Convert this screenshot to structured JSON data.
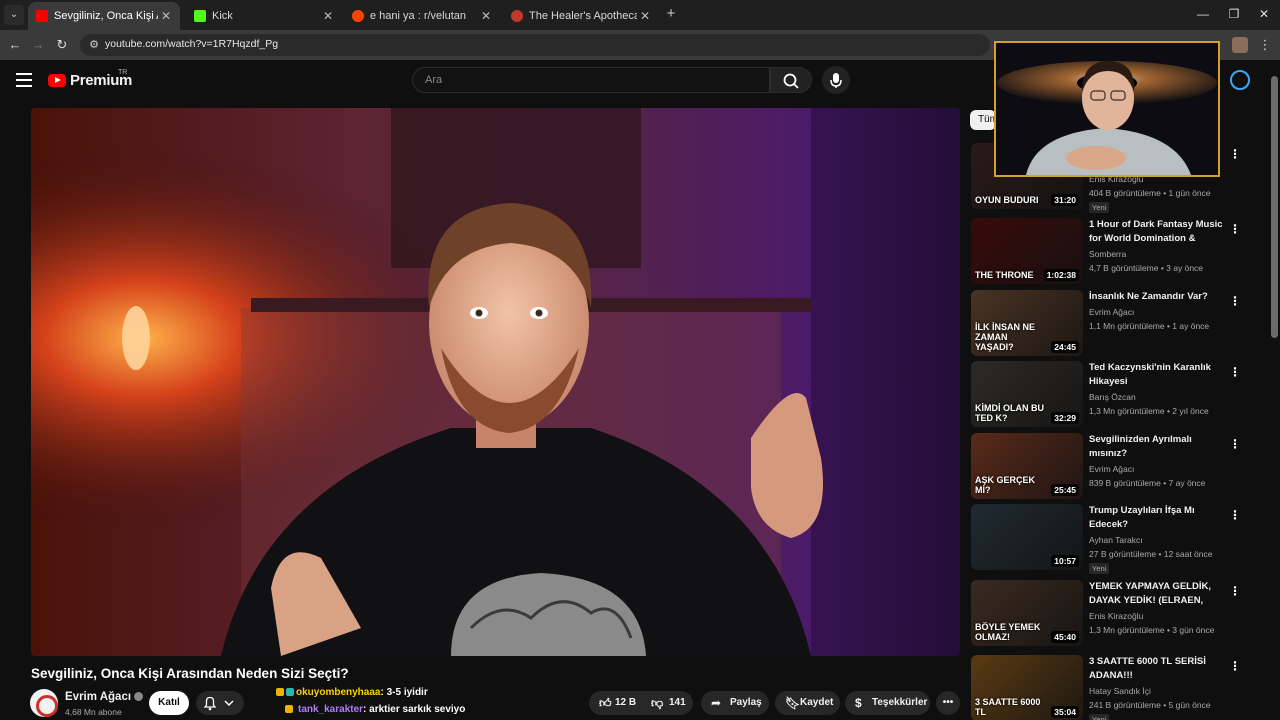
{
  "browser": {
    "tabs": [
      {
        "title": "Sevgiliniz, Onca Kişi Arasından",
        "favicon": "youtube-icon",
        "color": "#ff0000",
        "active": true
      },
      {
        "title": "Kick",
        "favicon": "kick-icon",
        "color": "#53fc18",
        "active": false
      },
      {
        "title": "e hani ya : r/velutan",
        "favicon": "reddit-icon",
        "color": "#ff4500",
        "active": false
      },
      {
        "title": "The Healer's Apothecary | Inkarr",
        "favicon": "site-icon",
        "color": "#c0392b",
        "active": false
      }
    ],
    "url": "youtube.com/watch?v=1R7Hqzdf_Pg"
  },
  "youtube": {
    "logo_text": "Premium",
    "region": "TR",
    "search_placeholder": "Ara"
  },
  "video": {
    "title": "Sevgiliniz, Onca Kişi Arasından Neden Sizi Seçti?",
    "channel": "Evrim Ağacı",
    "subscribers": "4,68 Mn abone",
    "join_label": "Katıl",
    "likes": "12 B",
    "dislikes": "141",
    "share_label": "Paylaş",
    "save_label": "Kaydet",
    "thanks_label": "Teşekkürler",
    "more_label": "•••"
  },
  "chat": [
    {
      "user": "okuyombenyhaaa",
      "message": ": 3-5 iyidir",
      "user_color": "#ffd200"
    },
    {
      "user": "tank_karakter",
      "message": ": arktier sarkık seviyo",
      "user_color": "#b07cff"
    }
  ],
  "sidebar": {
    "chip": "Tüm",
    "items": [
      {
        "title": "",
        "channel": "Enis Kirazoğlu",
        "meta": "404 B görüntüleme • 1 gün önce",
        "badge": "Yeni",
        "duration": "31:20",
        "thumb_text": "OYUN BUDURI",
        "thumb_color": "#2a1a1a"
      },
      {
        "title": "1 Hour of Dark Fantasy Music for World Domination & Villains",
        "channel": "Somberra",
        "meta": "4,7 B görüntüleme • 3 ay önce",
        "badge": "",
        "duration": "1:02:38",
        "thumb_text": "THE THRONE",
        "thumb_color": "#3a0a0a"
      },
      {
        "title": "İnsanlık Ne Zamandır Var?",
        "channel": "Evrim Ağacı",
        "meta": "1,1 Mn görüntüleme • 1 ay önce",
        "badge": "",
        "duration": "24:45",
        "thumb_text": "İLK İNSAN NE ZAMAN YAŞADI?",
        "thumb_color": "#4a3322"
      },
      {
        "title": "Ted Kaczynski'nin Karanlık Hikayesi",
        "channel": "Barış Özcan",
        "meta": "1,3 Mn görüntüleme • 2 yıl önce",
        "badge": "",
        "duration": "32:29",
        "thumb_text": "KİMDİ OLAN BU TED K?",
        "thumb_color": "#2d2a26"
      },
      {
        "title": "Sevgilinizden Ayrılmalı mısınız?",
        "channel": "Evrim Ağacı",
        "meta": "839 B görüntüleme • 7 ay önce",
        "badge": "",
        "duration": "25:45",
        "thumb_text": "AŞK GERÇEK Mİ?",
        "thumb_color": "#5a2a1a"
      },
      {
        "title": "Trump Uzaylıları İfşa Mı Edecek?",
        "channel": "Ayhan Tarakcı",
        "meta": "27 B görüntüleme • 12 saat önce",
        "badge": "Yeni",
        "duration": "10:57",
        "thumb_text": "",
        "thumb_color": "#1f2a30"
      },
      {
        "title": "YEMEK YAPMAYA GELDİK, DAYAK YEDİK! (ELRAEN, ERAY,...",
        "channel": "Enis Kirazoğlu",
        "meta": "1,3 Mn görüntüleme • 3 gün önce",
        "badge": "",
        "duration": "45:40",
        "thumb_text": "BÖYLE YEMEK OLMAZ!",
        "thumb_color": "#3a2a1f"
      },
      {
        "title": "3 SAATTE 6000 TL SERİSİ ADANA!!!",
        "channel": "Hatay Sandık İçi",
        "meta": "241 B görüntüleme • 5 gün önce",
        "badge": "Yeni",
        "duration": "35:04",
        "thumb_text": "3 SAATTE 6000 TL",
        "thumb_color": "#5a3a12"
      }
    ]
  }
}
